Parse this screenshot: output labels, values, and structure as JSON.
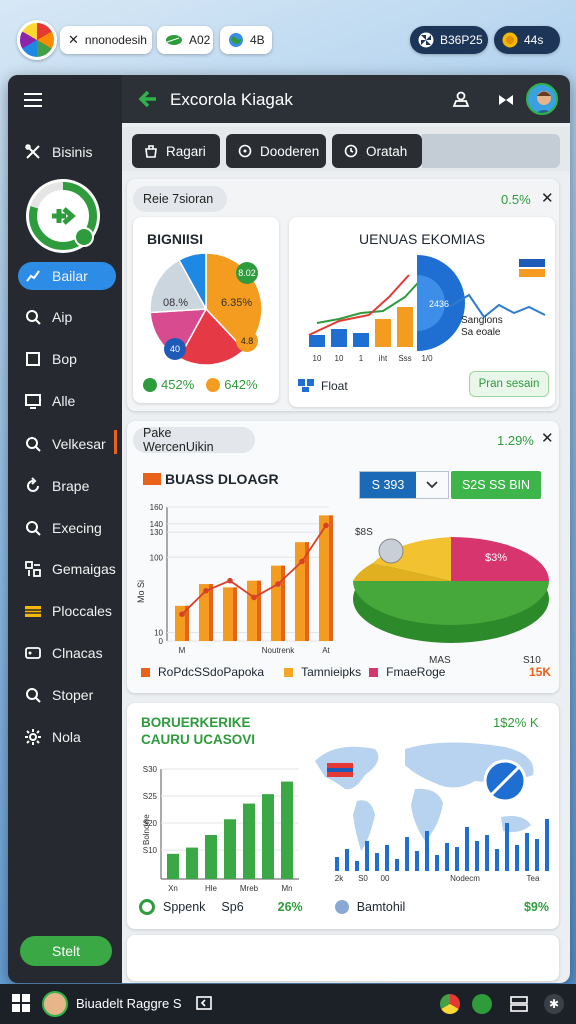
{
  "topbar": {
    "pill1_text": "nnonodesih",
    "pill2_text": "A02",
    "pill3_text": "4B",
    "pill4_text": "B36P25",
    "pill5_text": "44s"
  },
  "header": {
    "title": "Excorola Kiagak"
  },
  "sidebar": {
    "items": [
      {
        "label": "Bisinis",
        "icon": "tools-icon"
      },
      {
        "label": "Bailar",
        "icon": "chart-icon"
      },
      {
        "label": "Aip",
        "icon": "search-icon"
      },
      {
        "label": "Bop",
        "icon": "bracket-icon"
      },
      {
        "label": "Alle",
        "icon": "monitor-icon"
      },
      {
        "label": "Velkesar",
        "icon": "search-icon"
      },
      {
        "label": "Brape",
        "icon": "refresh-icon"
      },
      {
        "label": "Execing",
        "icon": "search-icon"
      },
      {
        "label": "Gemaigas",
        "icon": "grid-icon"
      },
      {
        "label": "Ploccales",
        "icon": "stripe-icon"
      },
      {
        "label": "Clnacas",
        "icon": "tag-icon"
      },
      {
        "label": "Stoper",
        "icon": "search-icon"
      },
      {
        "label": "Nola",
        "icon": "gear-icon"
      }
    ],
    "start_button": "Stelt"
  },
  "tabs": [
    {
      "label": "Ragari",
      "icon": "bag-icon"
    },
    {
      "label": "Dooderen",
      "icon": "chat-icon"
    },
    {
      "label": "Oratah",
      "icon": "clock-icon"
    }
  ],
  "section1": {
    "chip": "Reie 7sioran",
    "stat": "0.5%",
    "pie_card": {
      "title": "BIGNIISI",
      "label_a": "08.%",
      "label_b": "6.35%",
      "label_c": "8.02",
      "label_d": "4.8",
      "label_e": "40",
      "stat_a": "452%",
      "stat_b": "642%"
    },
    "combo_card": {
      "title": "UENUAS EKOMIAS",
      "legend_a": "Sangions",
      "legend_b": "Sa eoale",
      "slice_label": "2436",
      "x_ticks": [
        "10",
        "10",
        "1",
        "iht",
        "Sss",
        "1/0"
      ],
      "footer_label": "Float",
      "button": "Pran sesain"
    }
  },
  "section2": {
    "chip": "Pake WercenUikin",
    "stat": "1.29%",
    "title": "BUASS DLOAGR",
    "select_value": "S 393",
    "green_button": "S2S SS BIN",
    "y_ticks": [
      "160",
      "140",
      "130",
      "100",
      "10",
      "0"
    ],
    "y_label": "Mo Si",
    "x_ticks": [
      "M",
      "Noutrenk",
      "At"
    ],
    "pie_label": "$3%",
    "pie_top": "$8S",
    "pie_bottom_left": "MAS",
    "pie_bottom_right": "S10",
    "legend": [
      "RoPdcSSdoPapoka",
      "Tamnieipks",
      "FmaeRoge"
    ],
    "legend_value": "15K"
  },
  "section3": {
    "title_line1": "BORUERKERIKE",
    "title_line2": "CAURU UCASOVI",
    "stat": "1$2% K",
    "y_ticks": [
      "S30",
      "S25",
      "S20",
      "S10"
    ],
    "x_ticks": [
      "Xn",
      "Hle",
      "Mreb",
      "Mn"
    ],
    "y_label": "Bolnowe",
    "map_x_ticks": [
      "2k",
      "S0",
      "00",
      "Nodecm",
      "Tea"
    ],
    "footer_left_label": "Sppenk",
    "footer_left_value": "Sp6",
    "footer_left_pct": "26%",
    "footer_right_label": "Bamtohil",
    "footer_right_pct": "$9%"
  },
  "taskbar": {
    "user_label": "Biuadelt Raggre S"
  },
  "chart_data": [
    {
      "type": "pie",
      "title": "BIGNIISI",
      "labels": [
        "08.%",
        "6.35%",
        "8.02",
        "4.8",
        "40"
      ],
      "values": [
        38,
        20,
        16,
        18,
        8
      ],
      "colors": [
        "#f39c1f",
        "#e53945",
        "#d84b8e",
        "#ccd6df",
        "#1e88e5"
      ]
    },
    {
      "type": "bar",
      "title": "UENUAS EKOMIAS",
      "categories": [
        "10",
        "10",
        "1",
        "iht",
        "Sss",
        "1/0"
      ],
      "series": [
        {
          "values": [
            12,
            18,
            14,
            28,
            40,
            70
          ]
        },
        {
          "values": [
            10,
            14,
            20,
            22,
            36,
            60
          ]
        }
      ]
    },
    {
      "type": "bar",
      "title": "BUASS DLOAGR",
      "categories": [
        "M",
        "",
        "",
        "",
        "Noutrenk",
        "",
        "At"
      ],
      "series": [
        {
          "name": "RoPdcSSdoPapoka",
          "values": [
            32,
            60,
            72,
            52,
            68,
            95,
            138
          ]
        },
        {
          "name": "Tamnieipks",
          "values": [
            42,
            68,
            64,
            72,
            90,
            118,
            150
          ]
        }
      ],
      "ylim": [
        0,
        160
      ],
      "yticks": [
        0,
        10,
        100,
        130,
        140,
        160
      ]
    },
    {
      "type": "pie",
      "labels": [
        "$3%",
        "",
        ""
      ],
      "values": [
        30,
        35,
        35
      ],
      "colors": [
        "#d6356d",
        "#46a83a",
        "#f2c230"
      ]
    },
    {
      "type": "bar",
      "title": "BORUERKERIKE CAURU UCASOVI",
      "categories": [
        "Xn",
        "",
        "Hle",
        "",
        "Mreb",
        "",
        "Mn"
      ],
      "values": [
        8,
        10,
        14,
        19,
        24,
        27,
        31
      ],
      "ylim": [
        0,
        35
      ]
    }
  ]
}
